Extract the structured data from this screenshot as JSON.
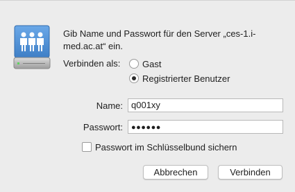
{
  "dialog": {
    "prompt": "Gib Name und Passwort für den Server „ces-1.i-med.ac.at“ ein.",
    "connect_as_label": "Verbinden als:",
    "radio_options": [
      {
        "label": "Gast",
        "selected": false
      },
      {
        "label": "Registrierter Benutzer",
        "selected": true
      }
    ],
    "name_label": "Name:",
    "name_value": "q001xy",
    "password_label": "Passwort:",
    "password_masked": "●●●●●●",
    "keychain_label": "Passwort im Schlüsselbund sichern",
    "keychain_checked": false,
    "cancel_label": "Abbrechen",
    "connect_label": "Verbinden"
  },
  "icon": {
    "name": "network-server-icon"
  },
  "colors": {
    "background": "#ececec",
    "server_icon_blue": "#4e8fd6",
    "field_border": "#b8b8b8"
  }
}
